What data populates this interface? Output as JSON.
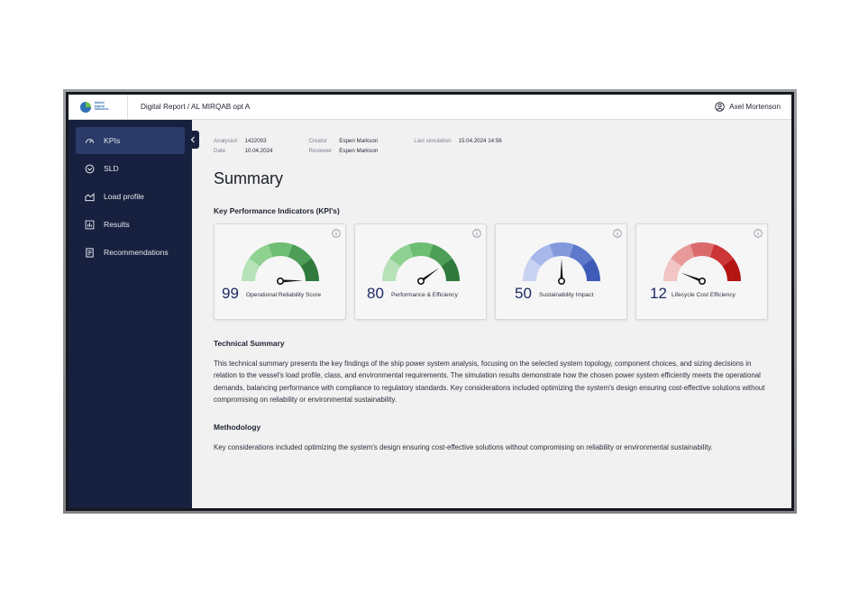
{
  "topbar": {
    "logo_text": [
      "Marine",
      "Hybrid",
      "Solutions"
    ],
    "breadcrumb": "Digital Report / AL MIRQAB opt A",
    "user_name": "Axel Mortenson"
  },
  "sidebar": {
    "items": [
      {
        "label": "KPIs",
        "icon": "gauge-icon",
        "active": true
      },
      {
        "label": "SLD",
        "icon": "diagram-icon",
        "active": false
      },
      {
        "label": "Load profile",
        "icon": "chart-area-icon",
        "active": false
      },
      {
        "label": "Results",
        "icon": "bar-chart-icon",
        "active": false
      },
      {
        "label": "Recommendations",
        "icon": "document-icon",
        "active": false
      }
    ]
  },
  "meta": {
    "analysis_label": "Analysis#",
    "analysis_value": "1422003",
    "date_label": "Date",
    "date_value": "10.04.2024",
    "creator_label": "Creator",
    "creator_value": "Espen Markson",
    "reviewer_label": "Reviewer",
    "reviewer_value": "Espen Markson",
    "last_sim_label": "Last simulation",
    "last_sim_value": "15.04.2024 14:56"
  },
  "main": {
    "title": "Summary",
    "kpi_heading": "Key Performance Indicators (KPI's)",
    "kpis": [
      {
        "value": "99",
        "label": "Operational Reliability Score",
        "score": 99,
        "colors": [
          "#b7e2b9",
          "#8fd191",
          "#6dbd73",
          "#4d9e56",
          "#2f7a3c"
        ]
      },
      {
        "value": "80",
        "label": "Performance & Efficiency",
        "score": 80,
        "colors": [
          "#b7e2b9",
          "#8fd191",
          "#6dbd73",
          "#4d9e56",
          "#2f7a3c"
        ]
      },
      {
        "value": "50",
        "label": "Sustainability Impact",
        "score": 50,
        "colors": [
          "#c8d3f2",
          "#a7b8ea",
          "#8299dc",
          "#5e79cc",
          "#3f5bb8"
        ]
      },
      {
        "value": "12",
        "label": "Lifecycle Cost Efficiency",
        "score": 12,
        "colors": [
          "#f3c4c4",
          "#e89a9a",
          "#db6a6a",
          "#cc3636",
          "#b31414"
        ]
      }
    ],
    "tech_heading": "Technical Summary",
    "tech_text": "This technical summary presents the key findings of the ship power system analysis, focusing on the selected system topology, component choices, and sizing decisions in relation to the vessel's load profile, class, and environmental requirements. The simulation results demonstrate how the chosen power system efficiently meets the operational demands, balancing performance with compliance to regulatory standards. Key considerations included optimizing the system's design ensuring cost-effective solutions without compromising on reliability or environmental sustainability.",
    "method_heading": "Methodology",
    "method_text": "Key considerations included optimizing the system's design ensuring cost-effective solutions without compromising on reliability or environmental sustainability."
  }
}
